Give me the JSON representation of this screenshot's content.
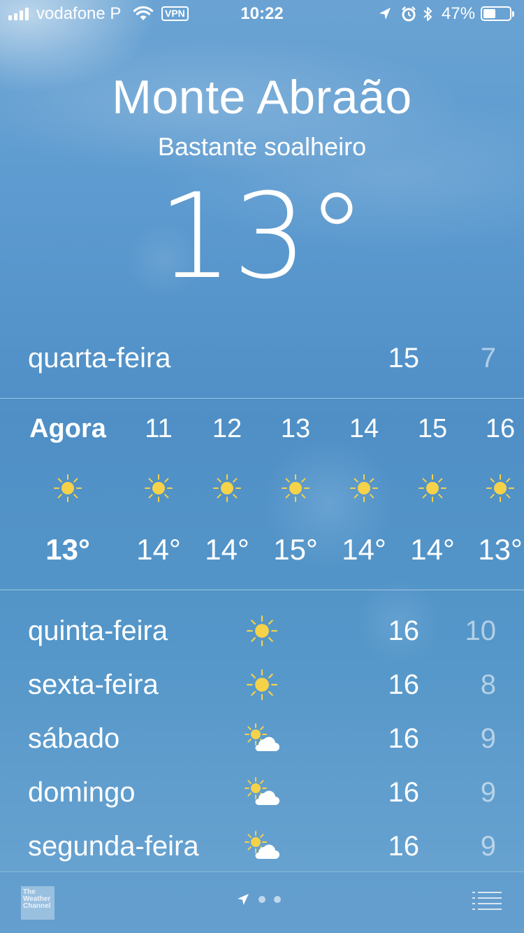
{
  "status_bar": {
    "carrier": "vodafone P",
    "vpn": "VPN",
    "time": "10:22",
    "battery_pct": "47%",
    "battery_level": 0.47,
    "signal_bars": 4
  },
  "location": {
    "city": "Monte Abraão",
    "condition": "Bastante soalheiro",
    "temperature": "13°"
  },
  "today": {
    "day": "quarta-feira",
    "high": "15",
    "low": "7"
  },
  "hourly": [
    {
      "hour": "Agora",
      "icon": "sun-icon",
      "temp": "13°"
    },
    {
      "hour": "11",
      "icon": "sun-icon",
      "temp": "14°"
    },
    {
      "hour": "12",
      "icon": "sun-icon",
      "temp": "14°"
    },
    {
      "hour": "13",
      "icon": "sun-icon",
      "temp": "15°"
    },
    {
      "hour": "14",
      "icon": "sun-icon",
      "temp": "14°"
    },
    {
      "hour": "15",
      "icon": "sun-icon",
      "temp": "14°"
    },
    {
      "hour": "16",
      "icon": "sun-icon",
      "temp": "13°"
    }
  ],
  "daily": [
    {
      "day": "quinta-feira",
      "icon": "sun-icon",
      "high": "16",
      "low": "10"
    },
    {
      "day": "sexta-feira",
      "icon": "sun-icon",
      "high": "16",
      "low": "8"
    },
    {
      "day": "sábado",
      "icon": "partly-cloudy-icon",
      "high": "16",
      "low": "9"
    },
    {
      "day": "domingo",
      "icon": "partly-cloudy-icon",
      "high": "16",
      "low": "9"
    },
    {
      "day": "segunda-feira",
      "icon": "partly-cloudy-icon",
      "high": "16",
      "low": "9"
    }
  ],
  "footer": {
    "logo_text": "The Weather Channel",
    "page_count": 2,
    "current_page": "location"
  },
  "colors": {
    "sun": "#f5d24a",
    "background": "#5a98cb"
  }
}
